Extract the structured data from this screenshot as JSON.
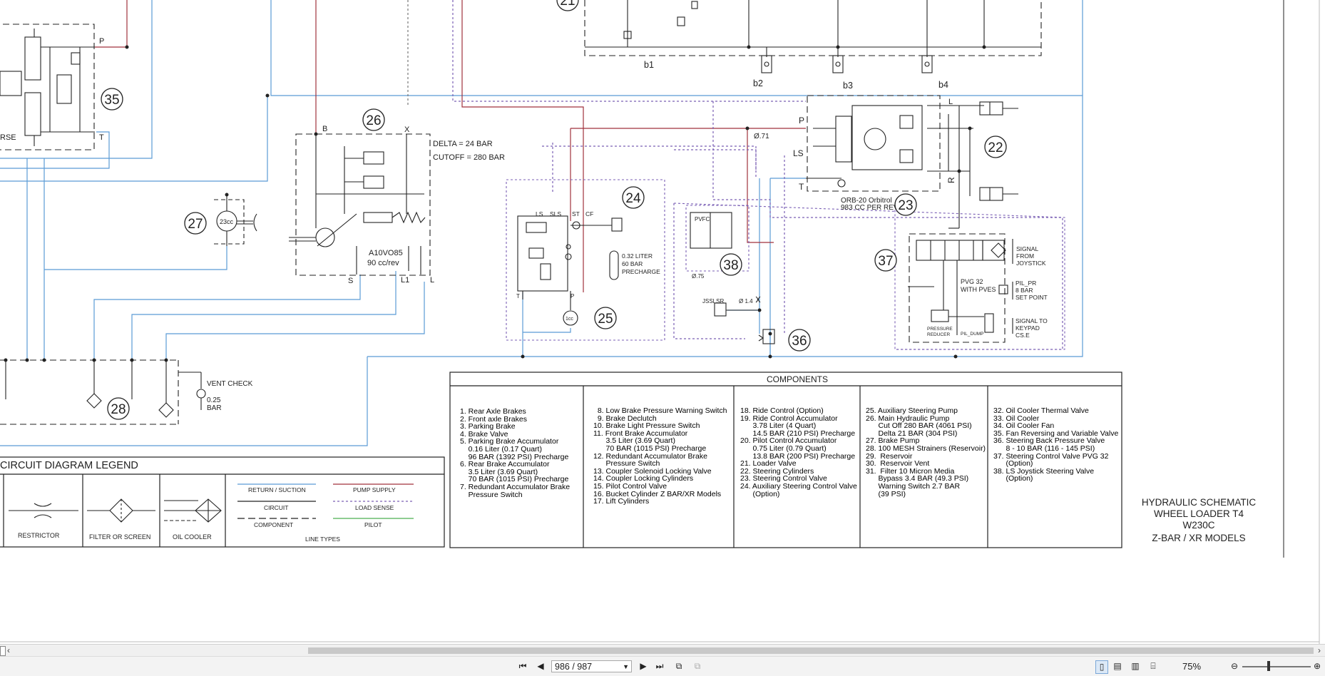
{
  "diagram": {
    "callouts": [
      "21",
      "35",
      "26",
      "27",
      "28",
      "24",
      "25",
      "38",
      "36",
      "23",
      "22",
      "37"
    ],
    "pump26": {
      "port_b": "B",
      "port_x": "X",
      "delta": "DELTA = 24 BAR",
      "cutoff": "CUTOFF = 280 BAR",
      "model": "A10VO85",
      "displacement": "90 cc/rev",
      "port_s": "S",
      "port_l1": "L1",
      "port_l": "L"
    },
    "pump27": "23cc",
    "valve35": {
      "port_p": "P",
      "port_t": "T",
      "text_rse": "RSE"
    },
    "bank21": {
      "b1": "b1",
      "b2": "b2",
      "b3": "b3",
      "b4": "b4"
    },
    "vent28": {
      "vent_check": "VENT CHECK",
      "pressure": "0.25",
      "unit": "BAR"
    },
    "valve24": {
      "ls": "LS",
      "sls": "SLS",
      "st": "ST",
      "cf": "CF",
      "acc_volume": "0.32 LITER",
      "acc_pressure": "60 BAR",
      "acc_precharge": "PRECHARGE",
      "port_t": "T",
      "port_p": "P"
    },
    "pump25": "1cc",
    "orbitrol23": {
      "port_p": "P",
      "port_ls": "LS",
      "port_t": "T",
      "port_r": "R",
      "port_l": "L",
      "orifice": "Ø.71",
      "model": "ORB-20 Orbitrol",
      "displacement": "983 CC PER REV"
    },
    "joystick38": {
      "pvfc": "PVFC",
      "orifice": "Ø.75",
      "jsslsr": "JSSLSR",
      "orifice2": "Ø 1.4"
    },
    "pvg37": {
      "model": "PVG 32",
      "with": "WITH PVES",
      "signal_joystick": [
        "SIGNAL",
        "FROM",
        "JOYSTICK"
      ],
      "pil_pr": "PIL_PR",
      "set_point": [
        "8 BAR",
        "SET POINT"
      ],
      "signal_keypad": [
        "SIGNAL TO",
        "KEYPAD",
        "CS.E"
      ],
      "pressure_reducer": [
        "PRESSURE",
        "REDUCER"
      ],
      "pil_dump": "PIL_DUMP"
    }
  },
  "legend": {
    "title": "CIRCUIT DIAGRAM LEGEND",
    "symbols": [
      "RESTRICTOR",
      "FILTER OR SCREEN",
      "OIL COOLER"
    ],
    "line_types_title": "LINE TYPES",
    "line_types": [
      {
        "label": "RETURN / SUCTION",
        "color": "#5b9bd5"
      },
      {
        "label": "PUMP SUPPLY",
        "color": "#a0323c"
      },
      {
        "label": "CIRCUIT",
        "color": "#222222"
      },
      {
        "label": "LOAD SENSE",
        "color": "#7a5fb5"
      },
      {
        "label": "COMPONENT",
        "color": "#222222"
      },
      {
        "label": "PILOT",
        "color": "#4caf50"
      }
    ]
  },
  "components": {
    "title": "COMPONENTS",
    "col1": [
      "1. Rear Axle Brakes",
      "2. Front axle Brakes",
      "3. Parking Brake",
      "4. Brake Valve",
      "5. Parking Brake Accumulator",
      "    0.16 Liter (0.17 Quart)",
      "    96 BAR (1392 PSI) Precharge",
      "6. Rear Brake Accumulator",
      "    3.5 Liter (3.69 Quart)",
      "    70 BAR (1015 PSI) Precharge",
      "7. Redundant Accumulator Brake",
      "    Pressure Switch"
    ],
    "col2": [
      "  8. Low Brake Pressure Warning Switch",
      "  9. Brake Declutch",
      "10. Brake Light Pressure Switch",
      "11. Front Brake Accumulator",
      "      3.5 Liter (3.69 Quart)",
      "      70 BAR (1015 PSI) Precharge",
      "12. Redundant Accumulator Brake",
      "      Pressure Switch",
      "13. Coupler Solenoid Locking Valve",
      "14. Coupler Locking Cylinders",
      "15. Pilot Control Valve",
      "16. Bucket Cylinder Z BAR/XR Models",
      "17. Lift Cylinders"
    ],
    "col3": [
      "18. Ride Control (Option)",
      "19. Ride Control Accumulator",
      "      3.78 Liter (4 Quart)",
      "      14.5 BAR (210 PSI) Precharge",
      "20. Pilot Control Accumulator",
      "      0.75 Liter (0.79 Quart)",
      "      13.8 BAR (200 PSI) Precharge",
      "21. Loader Valve",
      "22. Steering Cylinders",
      "23. Steering Control Valve",
      "24. Auxiliary Steering Control Valve",
      "      (Option)"
    ],
    "col4": [
      "25. Auxiliary Steering Pump",
      "26. Main Hydraulic Pump",
      "      Cut Off 280 BAR (4061 PSI)",
      "      Delta 21 BAR (304 PSI)",
      "27. Brake Pump",
      "28. 100 MESH Strainers (Reservoir)",
      "29.  Reservoir",
      "30.  Reservoir Vent",
      "31.  Filter 10 Micron Media",
      "      Bypass 3.4 BAR (49.3 PSI)",
      "      Warning Switch 2.7 BAR",
      "      (39 PSI)"
    ],
    "col5": [
      "32. Oil Cooler Thermal Valve",
      "33. Oil Cooler",
      "34. Oil Cooler Fan",
      "35. Fan Reversing and Variable Valve",
      "36. Steering Back Pressure Valve",
      "      8 - 10 BAR (116 - 145 PSI)",
      "37. Steering Control Valve PVG 32",
      "      (Option)",
      "38. LS Joystick Steering Valve",
      "      (Option)"
    ]
  },
  "title_block": {
    "line1": "HYDRAULIC SCHEMATIC",
    "line2": "WHEEL LOADER T4",
    "line3": "W230C",
    "line4": "Z-BAR /  XR MODELS"
  },
  "statusbar": {
    "page_value": "986 / 987",
    "zoom": "75%"
  }
}
